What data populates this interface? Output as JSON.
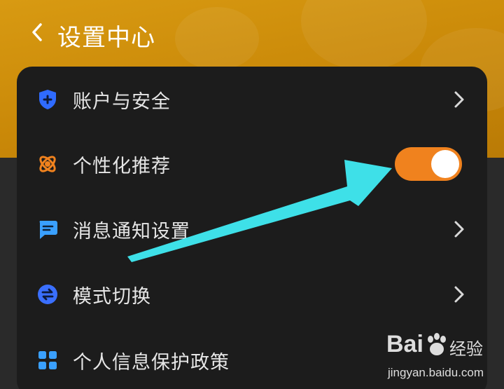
{
  "header": {
    "title": "设置中心",
    "back_icon": "chevron-left-icon"
  },
  "settings": {
    "items": [
      {
        "label": "账户与安全",
        "icon": "shield-plus-icon",
        "icon_color": "#2f6bff",
        "control": "chevron"
      },
      {
        "label": "个性化推荐",
        "icon": "atom-icon",
        "icon_color": "#f0821e",
        "control": "toggle",
        "toggle_on": true
      },
      {
        "label": "消息通知设置",
        "icon": "chat-bubble-icon",
        "icon_color": "#3aa0ff",
        "control": "chevron"
      },
      {
        "label": "模式切换",
        "icon": "switch-circle-icon",
        "icon_color": "#3a6fff",
        "control": "chevron"
      },
      {
        "label": "个人信息保护政策",
        "icon": "grid-apps-icon",
        "icon_color": "#3aa0ff",
        "control": "chevron"
      }
    ]
  },
  "annotation": {
    "arrow_color": "#3ee0e8",
    "points_to": "个性化推荐 toggle"
  },
  "watermark": {
    "logo": "Bai",
    "brand": "经验",
    "url": "jingyan.baidu.com"
  },
  "colors": {
    "header_bg": "#d2920e",
    "card_bg": "#1c1c1c",
    "toggle_on": "#f0821e"
  }
}
